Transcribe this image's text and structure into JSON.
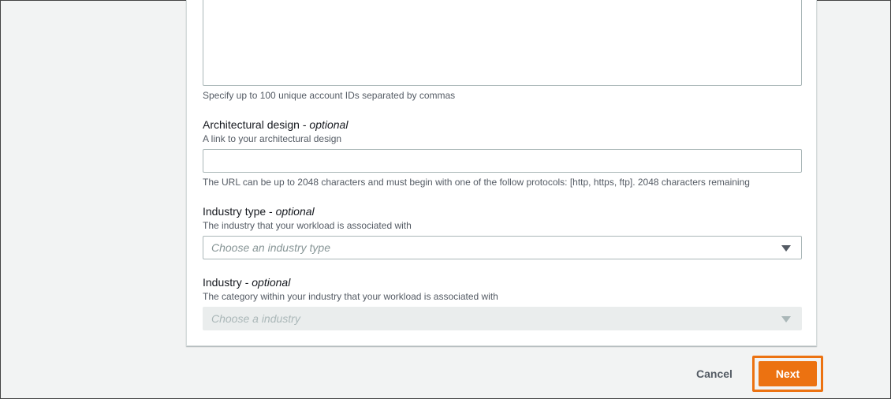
{
  "account_ids": {
    "hint": "Specify up to 100 unique account IDs separated by commas"
  },
  "architectural_design": {
    "label": "Architectural design",
    "optional": "optional",
    "description": "A link to your architectural design",
    "hint": "The URL can be up to 2048 characters and must begin with one of the follow protocols: [http, https, ftp]. 2048 characters remaining"
  },
  "industry_type": {
    "label": "Industry type",
    "optional": "optional",
    "description": "The industry that your workload is associated with",
    "placeholder": "Choose an industry type"
  },
  "industry": {
    "label": "Industry",
    "optional": "optional",
    "description": "The category within your industry that your workload is associated with",
    "placeholder": "Choose a industry"
  },
  "footer": {
    "cancel_label": "Cancel",
    "next_label": "Next"
  },
  "colors": {
    "primary": "#ec7211",
    "background": "#f2f3f3"
  }
}
